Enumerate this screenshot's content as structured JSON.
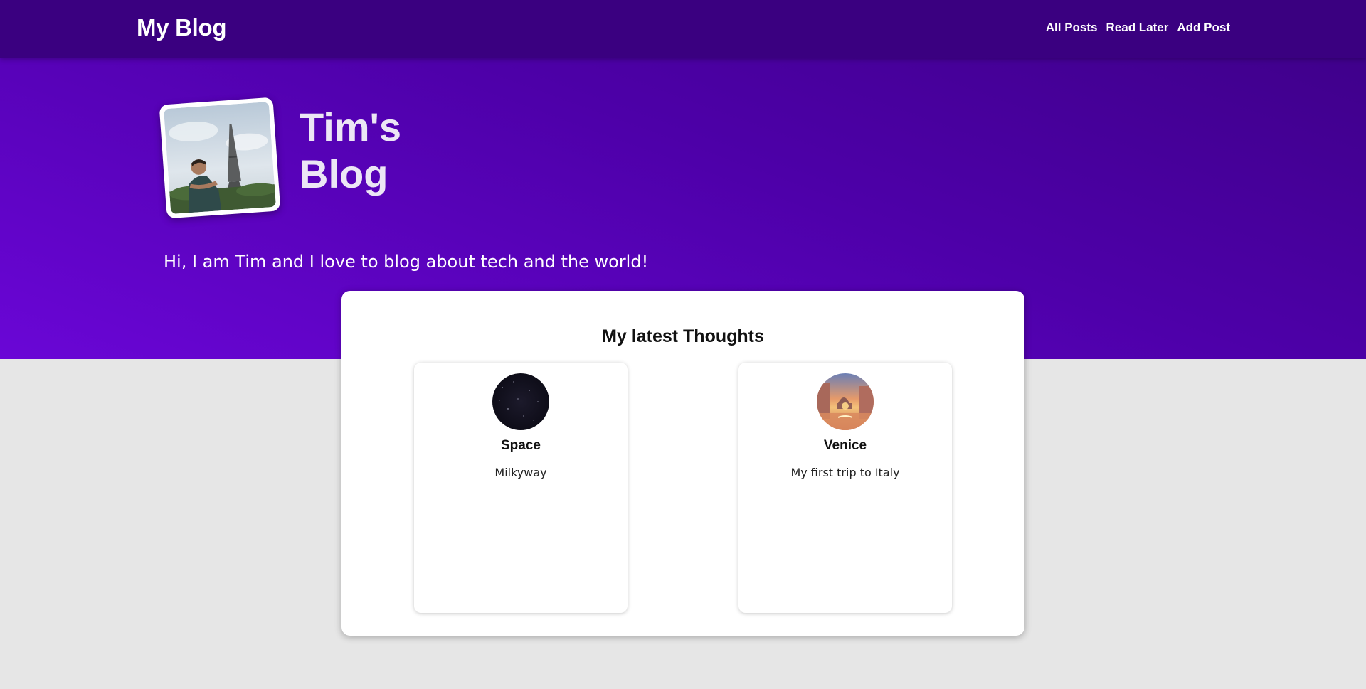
{
  "header": {
    "brand": "My Blog",
    "nav": [
      "All Posts",
      "Read Later",
      "Add Post"
    ]
  },
  "hero": {
    "title_line1": "Tim's",
    "title_line2": "Blog",
    "tagline": "Hi, I am Tim and I love to blog about tech and the world!",
    "photo_icon": "profile-photo-eiffel-tower"
  },
  "latest": {
    "heading": "My latest Thoughts",
    "posts": [
      {
        "title": "Space",
        "excerpt": "Milkyway",
        "thumb_icon": "starry-sky"
      },
      {
        "title": "Venice",
        "excerpt": "My first trip to Italy",
        "thumb_icon": "venice-canal-sunset"
      }
    ]
  },
  "colors": {
    "nav_bg": "#3a0080",
    "hero_gradient_start": "#3d0086",
    "hero_gradient_end": "#6a06d6",
    "page_bg": "#e6e6e6"
  }
}
